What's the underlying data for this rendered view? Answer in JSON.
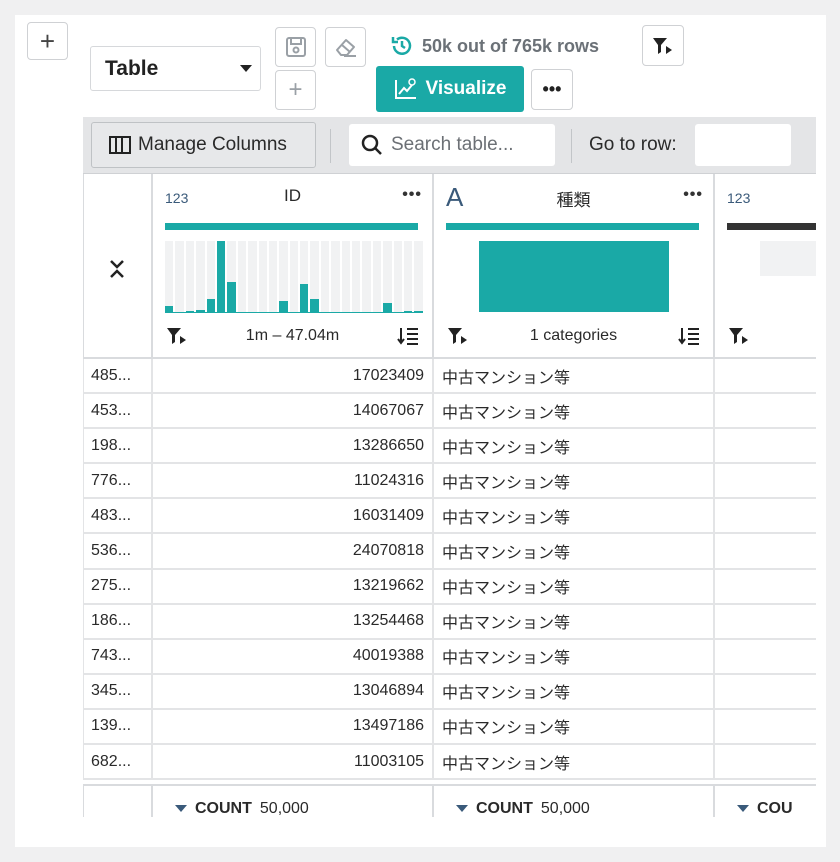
{
  "toolbar_top": {
    "add_cell_label": "+",
    "view_select_value": "Table",
    "plus_label": "+",
    "row_count_text": "50k out of 765k rows",
    "visualize_label": "Visualize",
    "more_label": "•••"
  },
  "table_toolbar": {
    "manage_columns_label": "Manage Columns",
    "search_placeholder": "Search table...",
    "goto_label": "Go to row:",
    "goto_value": ""
  },
  "columns": [
    {
      "type_label": "123",
      "name": "ID",
      "more": "•••",
      "summary": "1m – 47.04m"
    },
    {
      "type_label": "A",
      "name": "種類",
      "more": "•••",
      "summary": "1 categories"
    },
    {
      "type_label": "123",
      "name": "",
      "more": "",
      "summary": ""
    }
  ],
  "rows": [
    {
      "idx": "485...",
      "id": "17023409",
      "kind": "中古マンション等"
    },
    {
      "idx": "453...",
      "id": "14067067",
      "kind": "中古マンション等"
    },
    {
      "idx": "198...",
      "id": "13286650",
      "kind": "中古マンション等"
    },
    {
      "idx": "776...",
      "id": "11024316",
      "kind": "中古マンション等"
    },
    {
      "idx": "483...",
      "id": "16031409",
      "kind": "中古マンション等"
    },
    {
      "idx": "536...",
      "id": "24070818",
      "kind": "中古マンション等"
    },
    {
      "idx": "275...",
      "id": "13219662",
      "kind": "中古マンション等"
    },
    {
      "idx": "186...",
      "id": "13254468",
      "kind": "中古マンション等"
    },
    {
      "idx": "743...",
      "id": "40019388",
      "kind": "中古マンション等"
    },
    {
      "idx": "345...",
      "id": "13046894",
      "kind": "中古マンション等"
    },
    {
      "idx": "139...",
      "id": "13497186",
      "kind": "中古マンション等"
    },
    {
      "idx": "682...",
      "id": "11003105",
      "kind": "中古マンション等"
    }
  ],
  "footer": [
    {
      "agg": "COUNT",
      "value": "50,000"
    },
    {
      "agg": "COUNT",
      "value": "50,000"
    },
    {
      "agg": "COU",
      "value": ""
    }
  ],
  "id_histogram_levels": [
    0.1,
    0,
    0.03,
    0.04,
    0.2,
    1,
    0.43,
    0,
    0,
    0,
    0,
    0.17,
    0,
    0.4,
    0.2,
    0,
    0,
    0,
    0,
    0,
    0,
    0.14,
    0,
    0.03,
    0.03
  ],
  "colors": {
    "accent": "#1aa9a6",
    "panel": "#ffffff",
    "background": "#f0f0f1"
  }
}
